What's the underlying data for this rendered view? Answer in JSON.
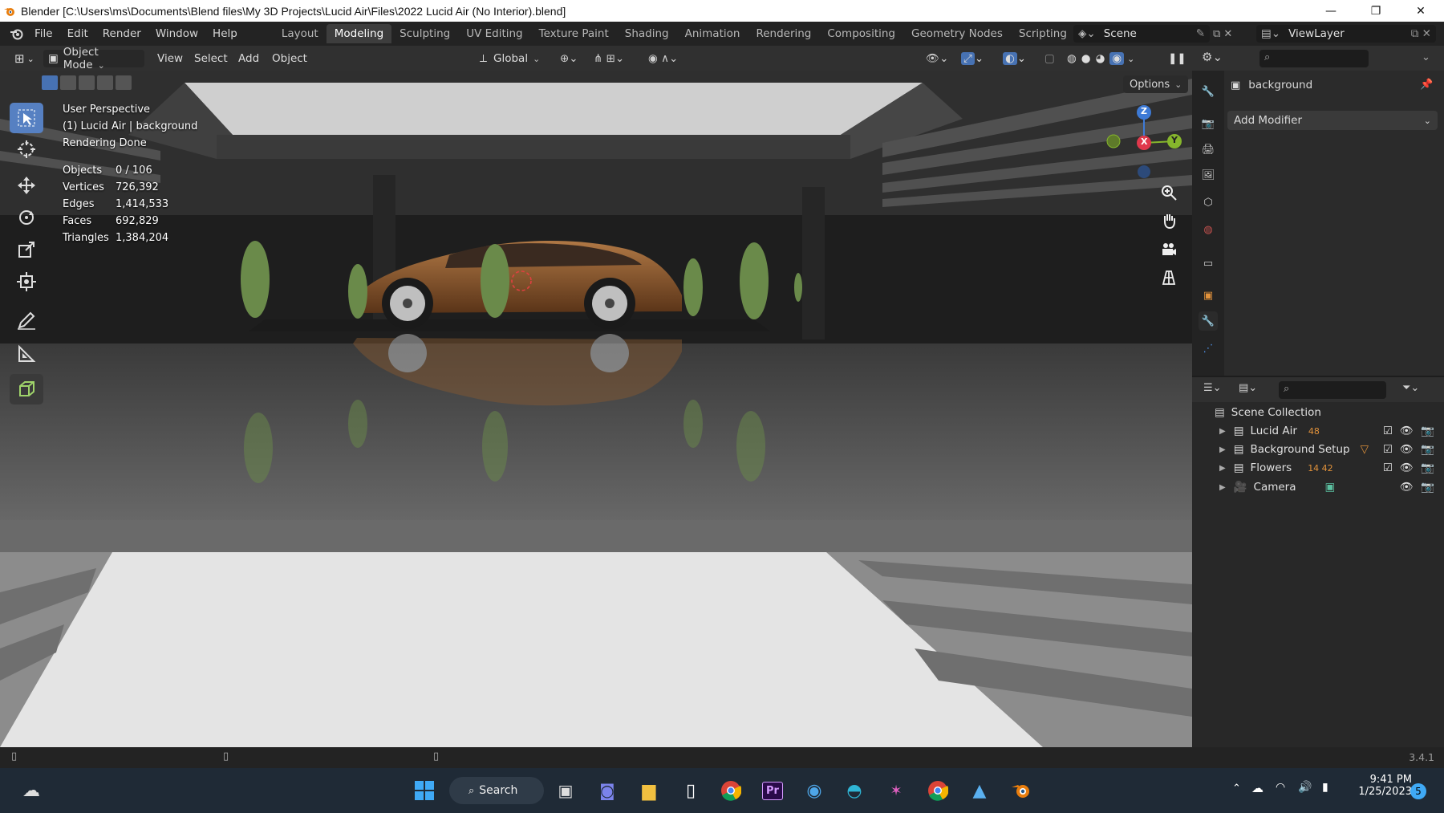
{
  "window": {
    "title": "Blender [C:\\Users\\ms\\Documents\\Blend files\\My 3D Projects\\Lucid Air\\Files\\2022 Lucid Air (No Interior).blend]",
    "minimize_glyph": "—",
    "maximize_glyph": "❐",
    "close_glyph": "✕"
  },
  "menu": {
    "items": [
      "File",
      "Edit",
      "Render",
      "Window",
      "Help"
    ],
    "workspaces": [
      "Layout",
      "Modeling",
      "Sculpting",
      "UV Editing",
      "Texture Paint",
      "Shading",
      "Animation",
      "Rendering",
      "Compositing",
      "Geometry Nodes",
      "Scripting"
    ],
    "active_workspace": "Modeling",
    "add_workspace": "+",
    "scene_name": "Scene",
    "view_layer": "ViewLayer"
  },
  "viewport_header": {
    "mode": "Object Mode",
    "menus": [
      "View",
      "Select",
      "Add",
      "Object"
    ],
    "transform_orientation": "Global",
    "options": "Options"
  },
  "viewport_overlay": {
    "view_name": "User Perspective",
    "active_object": "(1) Lucid Air | background",
    "render_status": "Rendering Done",
    "stats": [
      {
        "label": "Objects",
        "value": "0 / 106"
      },
      {
        "label": "Vertices",
        "value": "726,392"
      },
      {
        "label": "Edges",
        "value": "1,414,533"
      },
      {
        "label": "Faces",
        "value": "692,829"
      },
      {
        "label": "Triangles",
        "value": "1,384,204"
      }
    ],
    "gizmo_axes": {
      "z": "Z",
      "x": "X",
      "y": "Y"
    }
  },
  "properties": {
    "object_name": "background",
    "add_modifier": "Add Modifier"
  },
  "outliner": {
    "root": "Scene Collection",
    "items": [
      {
        "name": "Lucid Air",
        "badge": "48"
      },
      {
        "name": "Background Setup",
        "badge": ""
      },
      {
        "name": "Flowers",
        "badge": "14 42"
      },
      {
        "name": "Camera",
        "badge": ""
      }
    ]
  },
  "statusbar": {
    "version": "3.4.1"
  },
  "taskbar": {
    "search_label": "Search",
    "time": "9:41 PM",
    "date": "1/25/2023",
    "notification_count": "5"
  },
  "colors": {
    "accent": "#5680c2",
    "car_body": "#8a5a30",
    "axis_x": "#e0384c",
    "axis_y": "#86b62c",
    "axis_z": "#3d7ad6"
  }
}
